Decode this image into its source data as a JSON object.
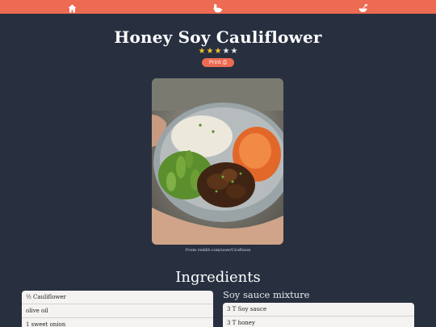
{
  "nav": {
    "icons": [
      "home-icon",
      "rabbit-icon",
      "bowl-whisk-icon"
    ],
    "background": "#ec6b52"
  },
  "recipe": {
    "title": "Honey Soy Cauliflower",
    "rating": {
      "filled": 3,
      "total": 5
    },
    "print_label": "Print ⎙",
    "photo_credit": "From reddit.com/user/Croftison"
  },
  "ingredients": {
    "heading": "Ingredients",
    "main_items": [
      "½ Cauliflower",
      "olive oil",
      "1 sweet onion"
    ],
    "soy_section": {
      "heading": "Soy sauce mixture",
      "items": [
        "3 T Soy sauce",
        "3 T honey"
      ]
    }
  },
  "colors": {
    "background": "#283040",
    "accent": "#ec6b52",
    "star": "#f2c230"
  }
}
